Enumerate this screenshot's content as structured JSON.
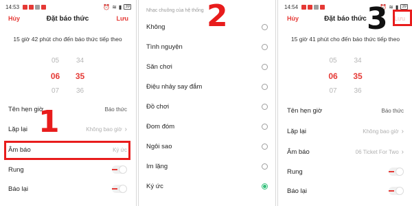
{
  "panel1": {
    "status_time": "14:53",
    "battery": "39",
    "cancel": "Hủy",
    "title": "Đặt báo thức",
    "save": "Lưu",
    "next_alarm": "15 giờ 42 phút cho đến báo thức tiếp theo",
    "picker_hours": [
      "05",
      "06",
      "07"
    ],
    "picker_minutes": [
      "34",
      "35",
      "36"
    ],
    "rows": {
      "name_label": "Tên hẹn giờ",
      "name_value": "Báo thức",
      "repeat_label": "Lặp lại",
      "repeat_value": "Không bao giờ",
      "sound_label": "Âm báo",
      "sound_value": "Ký ức",
      "vibrate_label": "Rung",
      "snooze_label": "Báo lại"
    },
    "marker": "1",
    "vibrate_on": false,
    "snooze_on": false
  },
  "panel2": {
    "hint": "Nhạc chuông của hệ thống",
    "marker": "2",
    "ringtones": [
      "Không",
      "Tình nguyện",
      "Săn chơi",
      "Điệu nhảy say đắm",
      "Đồ chơi",
      "Đom đóm",
      "Ngôi sao",
      "Im lặng",
      "Ký ức"
    ],
    "selected": "Ký ức"
  },
  "panel3": {
    "status_time": "14:54",
    "battery": "39",
    "cancel": "Hủy",
    "title": "Đặt báo thức",
    "save": "Lưu",
    "next_alarm": "15 giờ 41 phút cho đến báo thức tiếp theo",
    "picker_hours": [
      "05",
      "06",
      "07"
    ],
    "picker_minutes": [
      "34",
      "35",
      "36"
    ],
    "rows": {
      "name_label": "Tên hẹn giờ",
      "name_value": "Báo thức",
      "repeat_label": "Lặp lại",
      "repeat_value": "Không bao giờ",
      "sound_label": "Âm báo",
      "sound_value": "06 Ticket For Two",
      "vibrate_label": "Rung",
      "snooze_label": "Báo lại"
    },
    "marker": "3",
    "vibrate_on": false,
    "snooze_on": false
  },
  "colors": {
    "accent": "#e53935",
    "marker": "#e81c1c",
    "radio_selected": "#33c07a"
  }
}
